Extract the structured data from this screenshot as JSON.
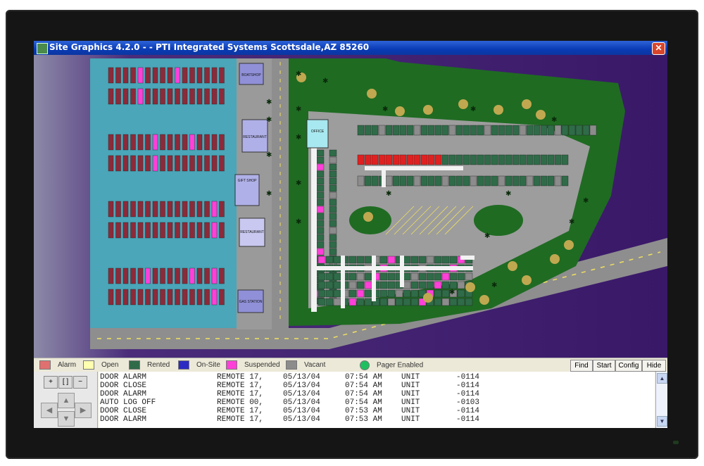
{
  "window": {
    "title": "Site Graphics 4.2.0 - - PTI Integrated Systems  Scottsdale,AZ 85260",
    "close_glyph": "✕"
  },
  "map": {
    "buildings": [
      "BOATSHOP",
      "RESTAURANT",
      "GIFT SHOP",
      "RESTAURANT",
      "GAS STATION",
      "OFFICE"
    ]
  },
  "legend": [
    {
      "label": "Alarm",
      "color": "#e07070"
    },
    {
      "label": "Open",
      "color": "#ffffb0"
    },
    {
      "label": "Rented",
      "color": "#2f6b48"
    },
    {
      "label": "On-Site",
      "color": "#2b2bc4"
    },
    {
      "label": "Suspended",
      "color": "#ff40d8"
    },
    {
      "label": "Vacant",
      "color": "#8c8c8c"
    },
    {
      "label": "Pager Enabled",
      "color": "#20c060"
    }
  ],
  "toolbar": {
    "find": "Find",
    "start": "Start",
    "config": "Config",
    "hide": "Hide"
  },
  "nav": {
    "zoom_in": "+",
    "zoom_fit": "[ ]",
    "zoom_out": "−"
  },
  "log": [
    {
      "event": "DOOR ALARM",
      "source": "REMOTE 17,",
      "date": "05/13/04",
      "time": "07:54 AM",
      "unit": "UNIT",
      "num": "-0114"
    },
    {
      "event": "DOOR CLOSE",
      "source": "REMOTE 17,",
      "date": "05/13/04",
      "time": "07:54 AM",
      "unit": "UNIT",
      "num": "-0114"
    },
    {
      "event": "DOOR ALARM",
      "source": "REMOTE 17,",
      "date": "05/13/04",
      "time": "07:54 AM",
      "unit": "UNIT",
      "num": "-0114"
    },
    {
      "event": "AUTO LOG OFF",
      "source": "REMOTE 00,",
      "date": "05/13/04",
      "time": "07:54 AM",
      "unit": "UNIT",
      "num": "-0103"
    },
    {
      "event": "DOOR CLOSE",
      "source": "REMOTE 17,",
      "date": "05/13/04",
      "time": "07:53 AM",
      "unit": "UNIT",
      "num": "-0114"
    },
    {
      "event": "DOOR ALARM",
      "source": "REMOTE 17,",
      "date": "05/13/04",
      "time": "07:53 AM",
      "unit": "UNIT",
      "num": "-0114"
    }
  ]
}
